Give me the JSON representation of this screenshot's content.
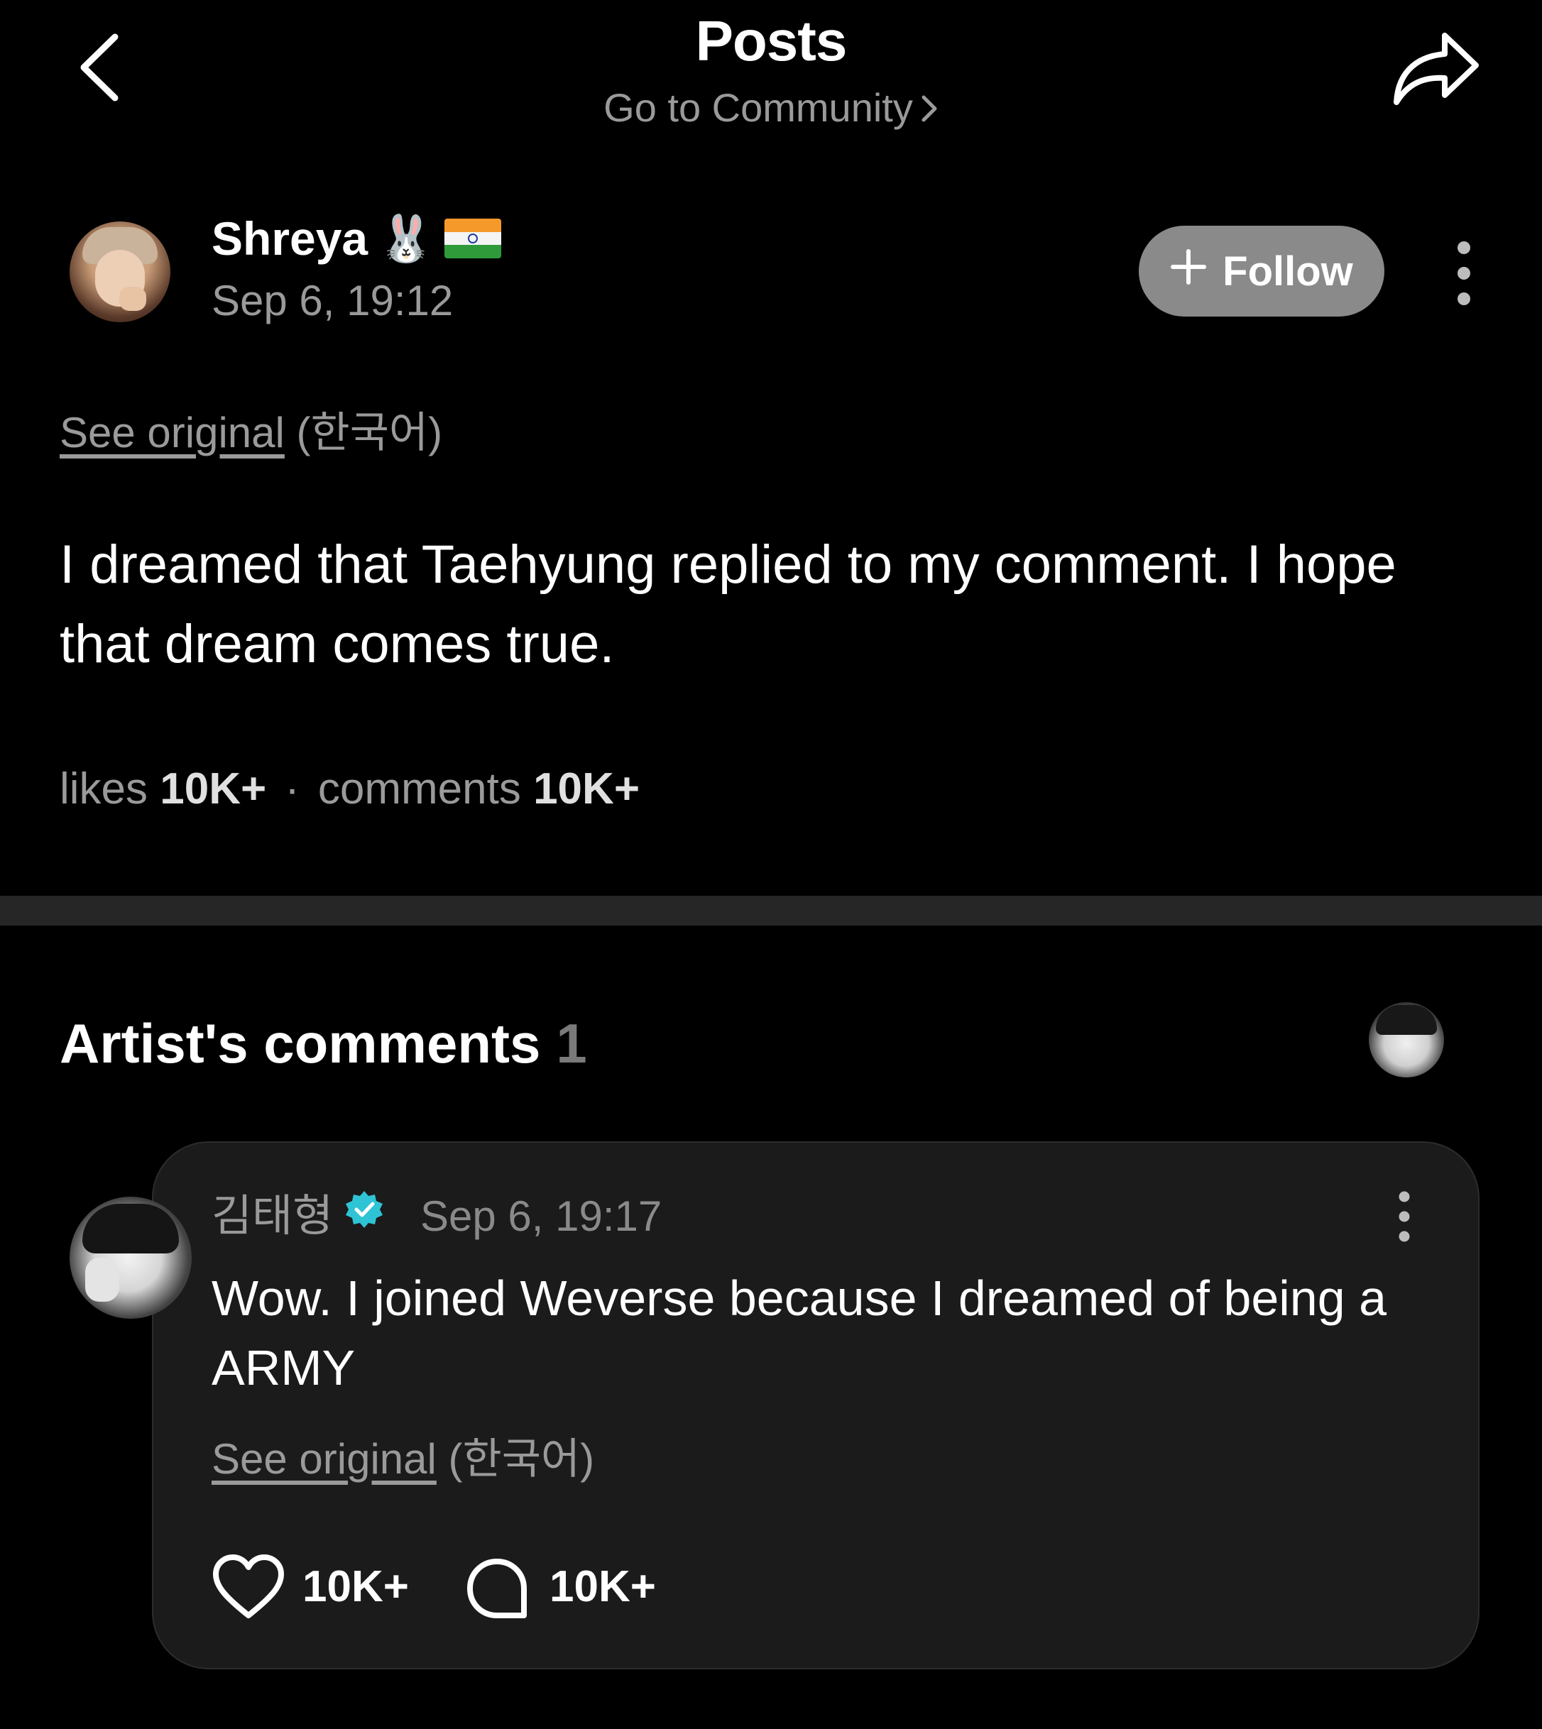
{
  "header": {
    "title": "Posts",
    "community_link": "Go to Community"
  },
  "post": {
    "author_name": "Shreya",
    "author_emoji": "🐰",
    "timestamp": "Sep 6, 19:12",
    "follow_label": "Follow",
    "see_original_link": "See original",
    "see_original_lang": "(한국어)",
    "body": "I dreamed that Taehyung replied to my comment. I hope that dream comes true.",
    "stats": {
      "likes_label": "likes",
      "likes_value": "10K+",
      "separator": "·",
      "comments_label": "comments",
      "comments_value": "10K+"
    }
  },
  "artist_comments": {
    "title": "Artist's comments",
    "count": "1",
    "comment": {
      "name": "김태형",
      "timestamp": "Sep 6, 19:17",
      "body": "Wow. I joined Weverse because I dreamed of being a ARMY",
      "see_original_link": "See original",
      "see_original_lang": "(한국어)",
      "likes": "10K+",
      "replies": "10K+"
    }
  },
  "colors": {
    "background": "#000000",
    "muted_text": "#9a9a9a",
    "follow_button": "#8a8a8a",
    "card_background": "#1b1b1b",
    "verified_badge": "#2ec4d6"
  },
  "icons": {
    "back": "chevron-left-icon",
    "share": "share-arrow-icon",
    "more": "more-vertical-icon",
    "like": "heart-icon",
    "reply": "comment-bubble-icon",
    "verified": "verified-badge-icon",
    "flag": "india-flag-icon"
  }
}
